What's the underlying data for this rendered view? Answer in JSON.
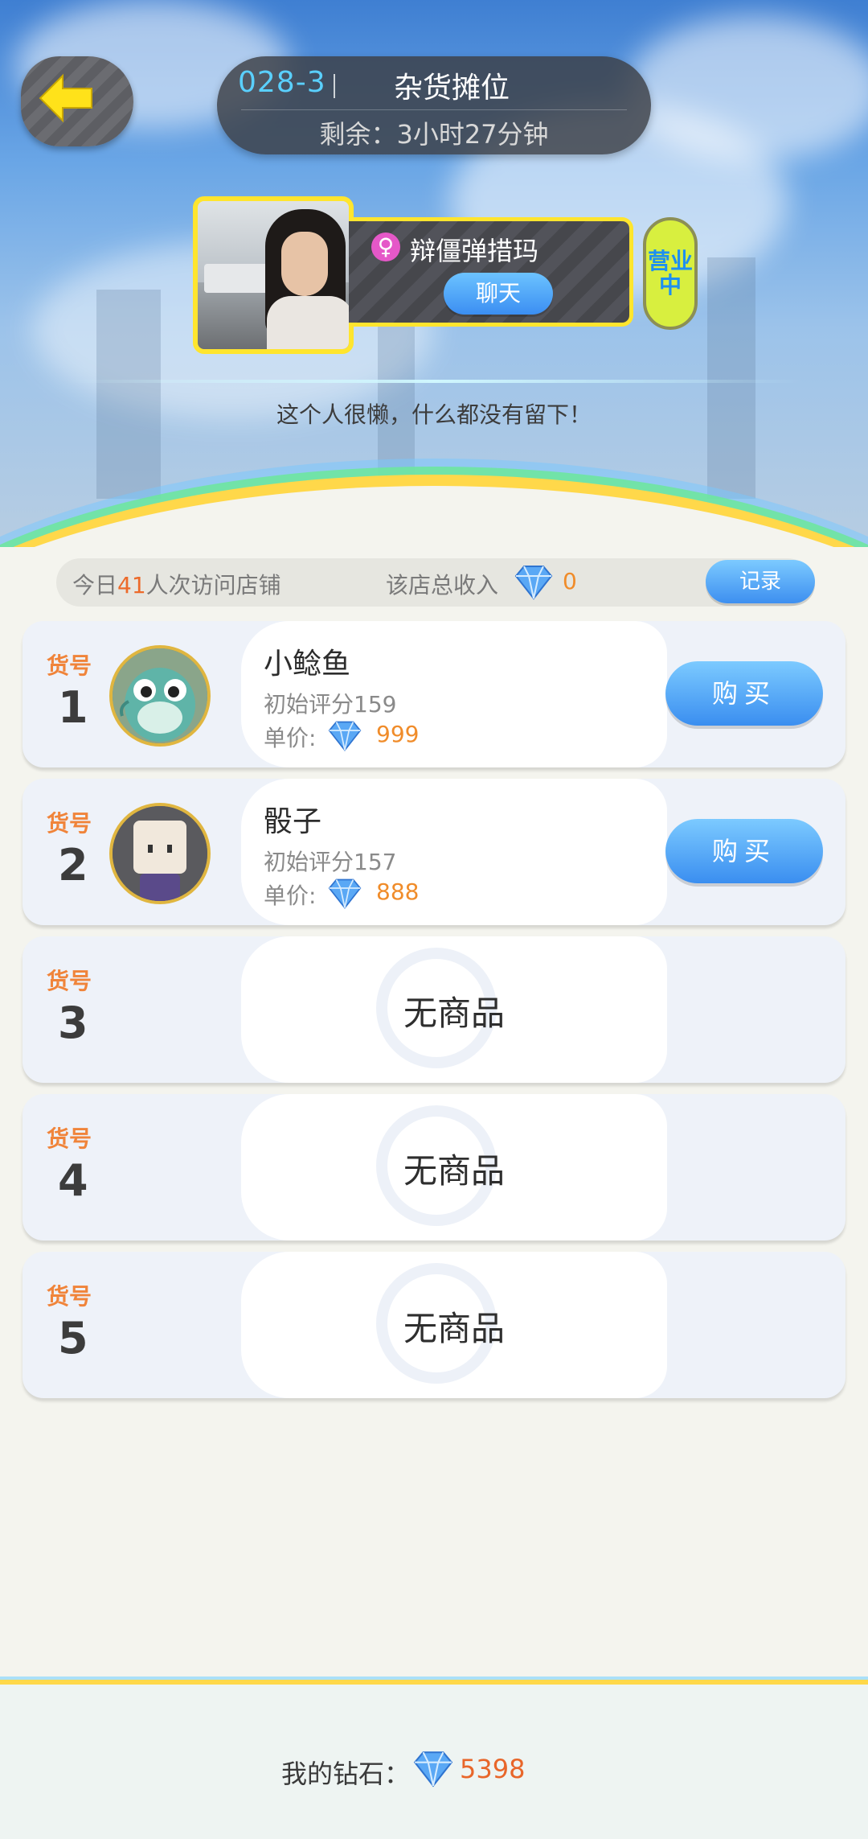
{
  "header": {
    "stall_id": "028-3",
    "stall_name": "杂货摊位",
    "remaining": "剩余：3小时27分钟"
  },
  "owner": {
    "name": "辩僵弹措玛",
    "chat_label": "聊天",
    "status": "营业中",
    "signature": "这个人很懒，什么都没有留下！"
  },
  "stats": {
    "visits_prefix": "今日",
    "visits_count": "41",
    "visits_suffix": "人次访问店铺",
    "income_label": "该店总收入",
    "income_value": "0",
    "record_label": "记录"
  },
  "slots": [
    {
      "label": "货号",
      "number": "1",
      "name": "小鲶鱼",
      "score": "初始评分159",
      "price_label": "单价:",
      "price": "999",
      "buy_label": "购买"
    },
    {
      "label": "货号",
      "number": "2",
      "name": "骰子",
      "score": "初始评分157",
      "price_label": "单价:",
      "price": "888",
      "buy_label": "购买"
    },
    {
      "label": "货号",
      "number": "3",
      "empty_label": "无商品"
    },
    {
      "label": "货号",
      "number": "4",
      "empty_label": "无商品"
    },
    {
      "label": "货号",
      "number": "5",
      "empty_label": "无商品"
    }
  ],
  "footer": {
    "my_gems_label": "我的钻石：",
    "my_gems_value": "5398"
  },
  "colors": {
    "accent_blue": "#3a8ef0",
    "highlight_orange": "#f08c2a",
    "border_yellow": "#ffe52e"
  }
}
